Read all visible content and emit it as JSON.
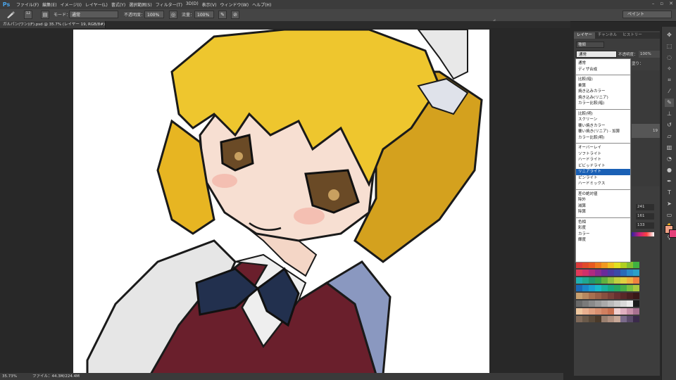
{
  "app": {
    "logo": "Ps"
  },
  "menu": [
    "ファイル(F)",
    "編集(E)",
    "イメージ(I)",
    "レイヤー(L)",
    "書式(Y)",
    "選択範囲(S)",
    "フィルター(T)",
    "3D(D)",
    "表示(V)",
    "ウィンドウ(W)",
    "ヘルプ(H)"
  ],
  "window_controls": {
    "minimize": "–",
    "restore": "▫",
    "close": "✕"
  },
  "options": {
    "brush_size": "12",
    "mode_label": "モード：",
    "mode_value": "通常",
    "opacity_label": "不透明度：",
    "opacity_value": "100%",
    "flow_label": "流量：",
    "flow_value": "100%",
    "workspace": "ペイント"
  },
  "document": {
    "tab_title": "ガルパン(ワン)(F).psd @ 35.7% (レイヤー 19, RGB/8#) *"
  },
  "status": {
    "zoom": "35.73%",
    "file_info": "ファイル：44.3M/224.4M"
  },
  "panel": {
    "tabs": [
      "レイヤー",
      "チャンネル",
      "ヒストリー"
    ],
    "kind_filter": "種類",
    "blend_current": "通常",
    "opacity_label": "不透明度：",
    "opacity_value": "100%",
    "fill_label": "塗り：",
    "fill_value": "100%",
    "layer_number": "19",
    "rgb_values": [
      "241",
      "161",
      "133"
    ]
  },
  "blend_modes": [
    [
      "通常",
      "ディザ合成"
    ],
    [
      "比較(暗)",
      "乗算",
      "焼き込みカラー",
      "焼き込み(リニア)",
      "カラー比較(暗)"
    ],
    [
      "比較(明)",
      "スクリーン",
      "覆い焼きカラー",
      "覆い焼き(リニア) - 加算",
      "カラー比較(明)"
    ],
    [
      "オーバーレイ",
      "ソフトライト",
      "ハードライト",
      "ビビッドライト",
      "リニアライト",
      "ピンライト",
      "ハードミックス"
    ],
    [
      "差の絶対値",
      "除外",
      "減算",
      "除算"
    ],
    [
      "色相",
      "彩度",
      "カラー",
      "輝度"
    ]
  ],
  "selected_blend": "リニアライト",
  "colors": {
    "foreground": "#f1a185",
    "background": "#e4407a",
    "selection": "#1a60b5"
  },
  "swatches": [
    [
      "#d93a3a",
      "#e04a2a",
      "#e85a20",
      "#ee7a1e",
      "#f09a20",
      "#f0c020",
      "#e0e020",
      "#b0d020",
      "#80c030",
      "#40b040"
    ],
    [
      "#e03a5a",
      "#d0306a",
      "#b02a80",
      "#8a2a90",
      "#6a2a9a",
      "#4a3aa0",
      "#3a4aa8",
      "#2a6ab8",
      "#2a8ac8",
      "#2aa0c8"
    ],
    [
      "#20b0b0",
      "#20a890",
      "#209870",
      "#30a050",
      "#60b040",
      "#90c040",
      "#c0d040",
      "#e0d040",
      "#f0b040",
      "#f08040"
    ],
    [
      "#1a6ab8",
      "#1a88c8",
      "#1aa0d0",
      "#1ab8c8",
      "#18b0a0",
      "#18a880",
      "#28a860",
      "#48b048",
      "#78c040",
      "#a8c840"
    ],
    [
      "#c8a070",
      "#b88860",
      "#a87050",
      "#986048",
      "#885040",
      "#784038",
      "#683030",
      "#582828",
      "#482020",
      "#381818"
    ],
    [
      "#6a6a6a",
      "#7a7a7a",
      "#8a8a8a",
      "#9a9a9a",
      "#aaaaaa",
      "#bababa",
      "#cacaca",
      "#dadada",
      "#eaeaea",
      "#1a1a1a"
    ],
    [
      "#f0c8a0",
      "#e8b090",
      "#e0a080",
      "#d89070",
      "#d08060",
      "#c87050",
      "#f0d0d0",
      "#e0b0c0",
      "#c890a8",
      "#a87090"
    ],
    [
      "#806a5a",
      "#6a5a4a",
      "#5a4a3a",
      "#4a3a2a",
      "#9a8070",
      "#b09080",
      "#c8a898",
      "#7a6a8a",
      "#5a4a6a",
      "#3a2a4a"
    ]
  ]
}
